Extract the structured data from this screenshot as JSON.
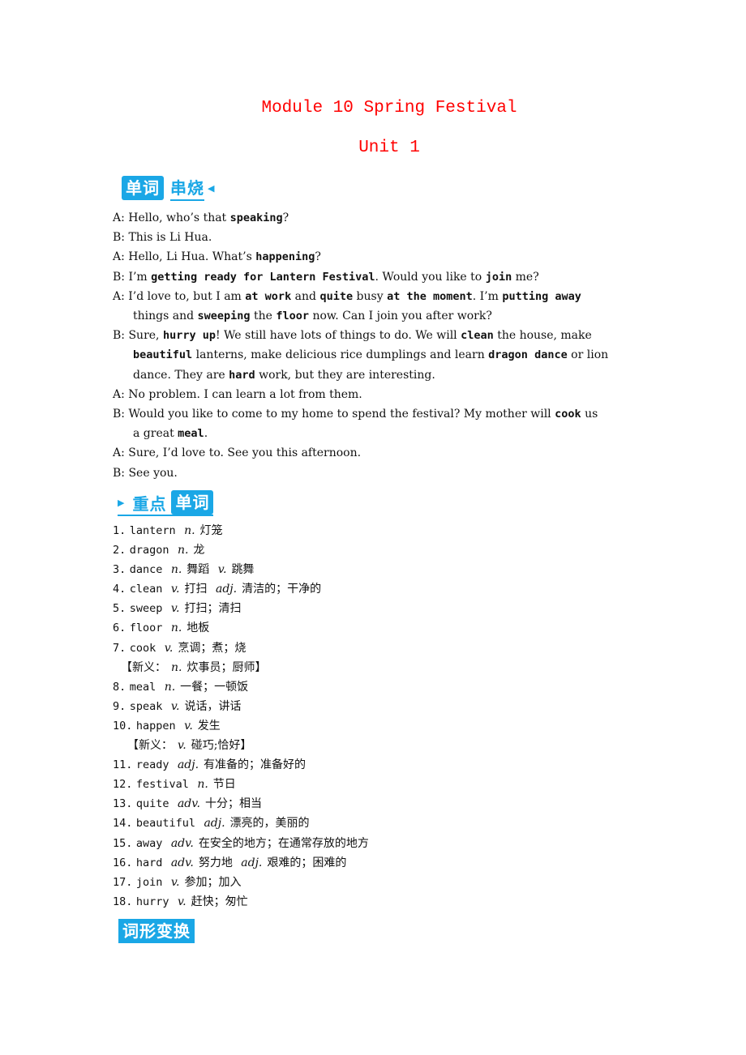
{
  "header": {
    "title": "Module 10  Spring Festival",
    "subtitle": "Unit 1"
  },
  "sections": {
    "dialogue_badge": {
      "block": "单词",
      "text": "串烧"
    },
    "vocab_badge": {
      "text": "重点",
      "block": "单词"
    },
    "forms_badge": {
      "block": "词形变换"
    }
  },
  "dialogue": [
    {
      "indent": false,
      "parts": [
        {
          "t": "A: Hello, who’s that "
        },
        {
          "b": "speaking"
        },
        {
          "t": "?"
        }
      ]
    },
    {
      "indent": false,
      "parts": [
        {
          "t": "B: This is Li Hua."
        }
      ]
    },
    {
      "indent": false,
      "parts": [
        {
          "t": "A: Hello, Li Hua. What’s "
        },
        {
          "b": "happening"
        },
        {
          "t": "?"
        }
      ]
    },
    {
      "indent": false,
      "parts": [
        {
          "t": "B: I’m "
        },
        {
          "b": "getting ready for Lantern Festival"
        },
        {
          "t": ". Would you like to "
        },
        {
          "b": "join"
        },
        {
          "t": " me?"
        }
      ]
    },
    {
      "indent": false,
      "parts": [
        {
          "t": "A: I’d love to, but I am "
        },
        {
          "b": "at work"
        },
        {
          "t": " and "
        },
        {
          "b": "quite"
        },
        {
          "t": " busy "
        },
        {
          "b": "at the moment"
        },
        {
          "t": ". I’m "
        },
        {
          "b": "putting away"
        }
      ]
    },
    {
      "indent": true,
      "parts": [
        {
          "t": "things and "
        },
        {
          "b": "sweeping"
        },
        {
          "t": " the "
        },
        {
          "b": "floor"
        },
        {
          "t": " now. Can I join you after work?"
        }
      ]
    },
    {
      "indent": false,
      "parts": [
        {
          "t": "B: Sure, "
        },
        {
          "b": "hurry up"
        },
        {
          "t": "! We still have lots of things to do. We will "
        },
        {
          "b": "clean"
        },
        {
          "t": " the house, make"
        }
      ]
    },
    {
      "indent": true,
      "parts": [
        {
          "b": "beautiful"
        },
        {
          "t": " lanterns, make delicious rice dumplings and learn "
        },
        {
          "b": "dragon dance"
        },
        {
          "t": " or lion"
        }
      ]
    },
    {
      "indent": true,
      "parts": [
        {
          "t": "dance. They are "
        },
        {
          "b": "hard"
        },
        {
          "t": " work, but they are interesting."
        }
      ]
    },
    {
      "indent": false,
      "parts": [
        {
          "t": "A: No problem. I can learn a lot from them."
        }
      ]
    },
    {
      "indent": false,
      "parts": [
        {
          "t": "B: Would you like to come to my home to spend the festival? My mother will "
        },
        {
          "b": "cook"
        },
        {
          "t": " us"
        }
      ]
    },
    {
      "indent": true,
      "parts": [
        {
          "t": "a great "
        },
        {
          "b": "meal"
        },
        {
          "t": "."
        }
      ]
    },
    {
      "indent": false,
      "parts": [
        {
          "t": "A: Sure, I’d love to. See you this afternoon."
        }
      ]
    },
    {
      "indent": false,
      "parts": [
        {
          "t": "B: See you."
        }
      ]
    }
  ],
  "vocab": [
    {
      "num": "1.",
      "word": "lantern",
      "defs": [
        {
          "pos": "n.",
          "cn": "灯笼"
        }
      ]
    },
    {
      "num": "2.",
      "word": "dragon",
      "defs": [
        {
          "pos": "n.",
          "cn": "龙"
        }
      ]
    },
    {
      "num": "3.",
      "word": "dance",
      "defs": [
        {
          "pos": "n.",
          "cn": "舞蹈"
        },
        {
          "pos": "v.",
          "cn": "跳舞"
        }
      ]
    },
    {
      "num": "4.",
      "word": "clean",
      "defs": [
        {
          "pos": "v.",
          "cn": "打扫"
        },
        {
          "pos": "adj.",
          "cn": "清洁的；干净的"
        }
      ]
    },
    {
      "num": "5.",
      "word": "sweep",
      "defs": [
        {
          "pos": "v.",
          "cn": "打扫；清扫"
        }
      ]
    },
    {
      "num": "6.",
      "word": "floor",
      "defs": [
        {
          "pos": "n.",
          "cn": "地板"
        }
      ]
    },
    {
      "num": "7.",
      "word": "cook",
      "defs": [
        {
          "pos": "v.",
          "cn": "烹调；煮；烧"
        }
      ],
      "note": {
        "prefix": "【新义：",
        "pos": "n.",
        "cn": "炊事员；厨师】"
      }
    },
    {
      "num": "8.",
      "word": "meal",
      "defs": [
        {
          "pos": "n.",
          "cn": "一餐；一顿饭"
        }
      ]
    },
    {
      "num": "9.",
      "word": "speak",
      "defs": [
        {
          "pos": "v.",
          "cn": "说话，讲话"
        }
      ]
    },
    {
      "num": "10.",
      "word": "happen",
      "defs": [
        {
          "pos": "v.",
          "cn": "发生"
        }
      ],
      "note": {
        "prefix": "【新义：",
        "pos": "v.",
        "cn": "碰巧;恰好】"
      }
    },
    {
      "num": "11.",
      "word": "ready",
      "defs": [
        {
          "pos": "adj.",
          "cn": "有准备的；准备好的"
        }
      ]
    },
    {
      "num": "12.",
      "word": "festival",
      "defs": [
        {
          "pos": "n.",
          "cn": "节日"
        }
      ]
    },
    {
      "num": "13.",
      "word": "quite",
      "defs": [
        {
          "pos": "adv.",
          "cn": "十分；相当"
        }
      ]
    },
    {
      "num": "14.",
      "word": "beautiful",
      "defs": [
        {
          "pos": "adj.",
          "cn": "漂亮的，美丽的"
        }
      ]
    },
    {
      "num": "15.",
      "word": "away",
      "defs": [
        {
          "pos": "adv.",
          "cn": "在安全的地方；在通常存放的地方"
        }
      ]
    },
    {
      "num": "16.",
      "word": "hard",
      "defs": [
        {
          "pos": "adv.",
          "cn": "努力地"
        },
        {
          "pos": "adj.",
          "cn": "艰难的；困难的"
        }
      ]
    },
    {
      "num": "17.",
      "word": "join",
      "defs": [
        {
          "pos": "v.",
          "cn": "参加；加入"
        }
      ]
    },
    {
      "num": "18.",
      "word": "hurry",
      "defs": [
        {
          "pos": "v.",
          "cn": "赶快；匆忙"
        }
      ]
    }
  ]
}
